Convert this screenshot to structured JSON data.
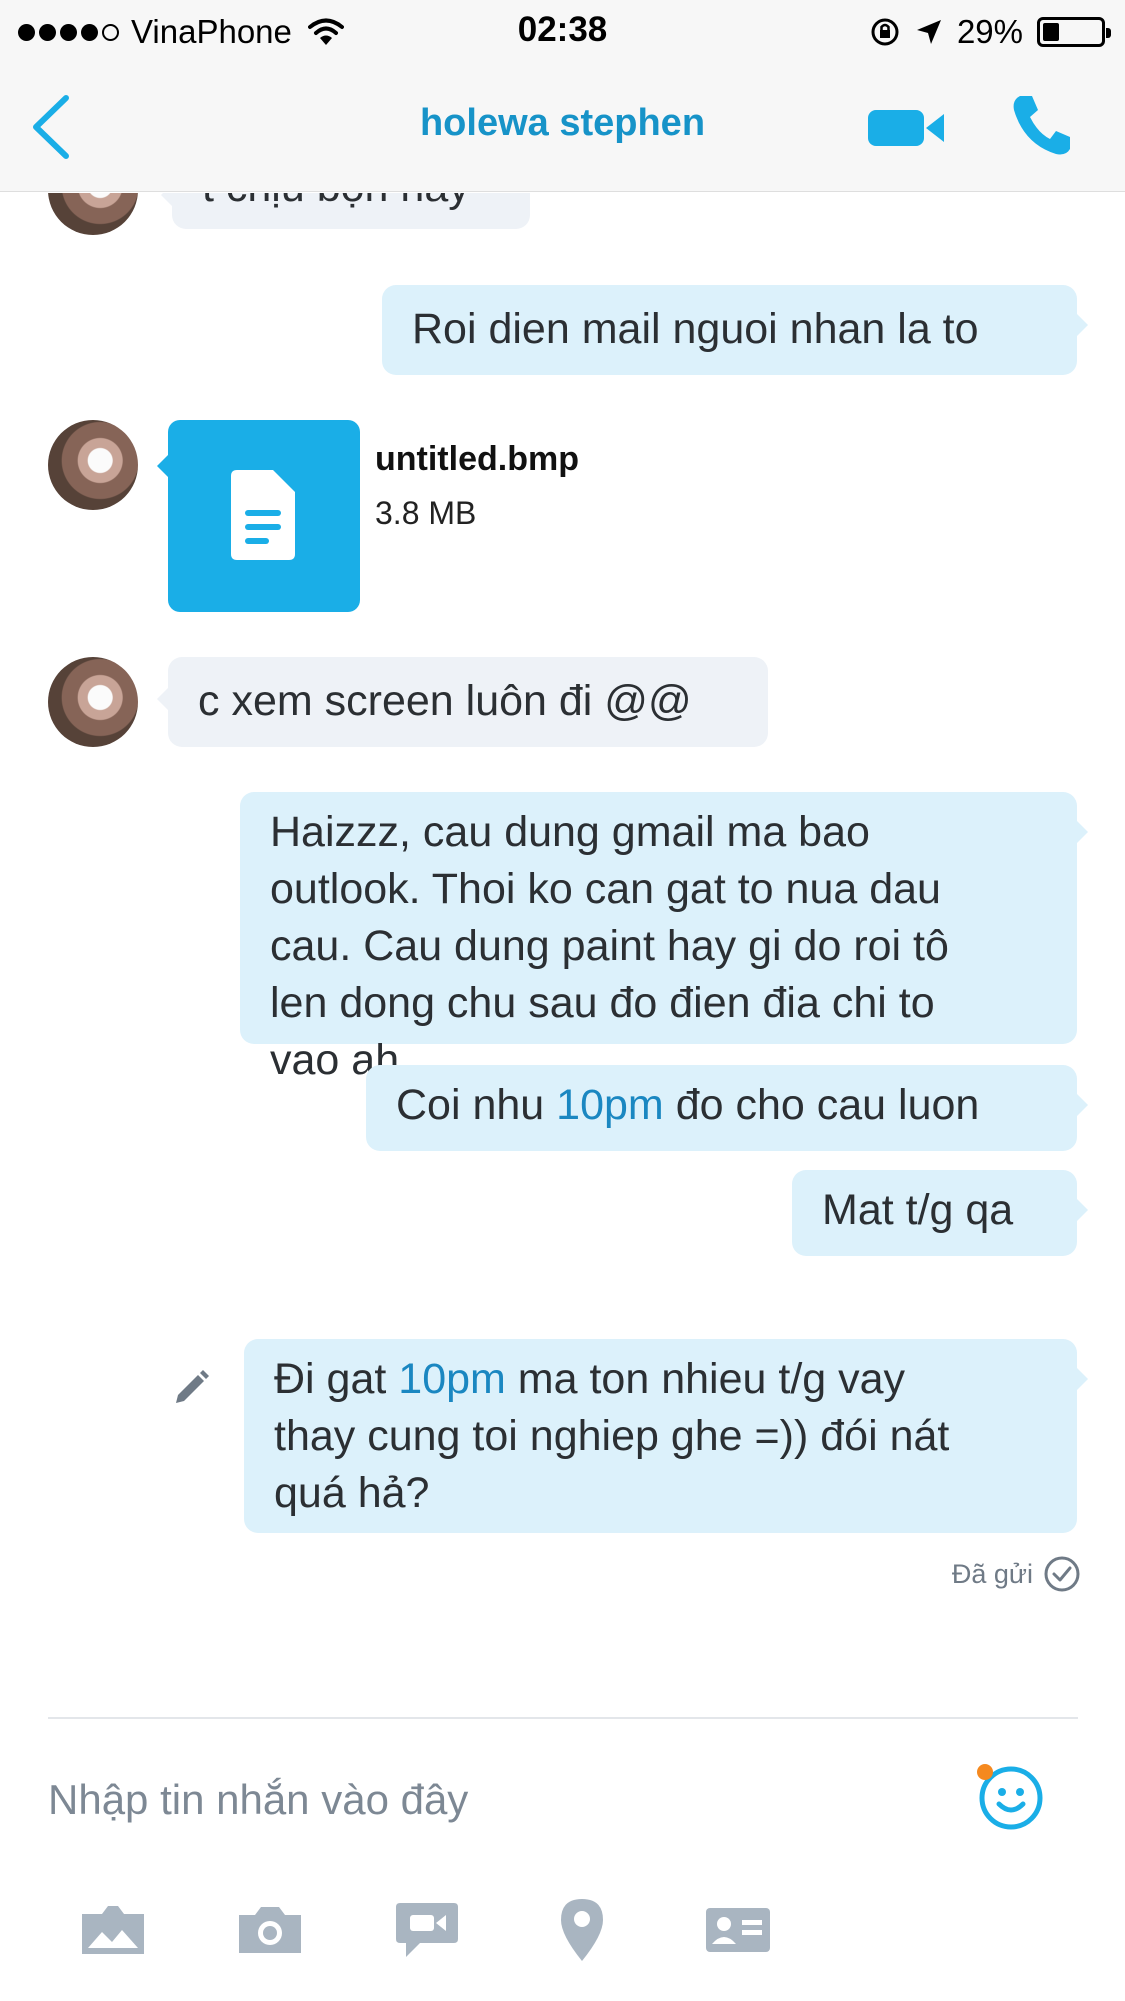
{
  "status_bar": {
    "carrier": "VinaPhone",
    "time": "02:38",
    "battery": "29%",
    "battery_level": 0.29
  },
  "header": {
    "back_icon": "chevron-left-icon",
    "contact_name": "holewa stephen",
    "video_icon": "video-camera-icon",
    "call_icon": "phone-icon"
  },
  "messages": {
    "m0": {
      "sender": "them",
      "text": "t chịu bọn hay"
    },
    "m1": {
      "sender": "me",
      "text": "Roi dien mail nguoi nhan la to"
    },
    "m2": {
      "sender": "them",
      "file_name": "untitled.bmp",
      "file_size": "3.8 MB",
      "icon": "document-icon"
    },
    "m3": {
      "sender": "them",
      "text": "c xem screen luôn đi @@"
    },
    "m4": {
      "sender": "me",
      "lines": [
        "Haizzz, cau dung gmail ma bao",
        "outlook. Thoi ko can gat to nua dau",
        "cau. Cau dung paint hay gi do roi tô",
        "len dong chu sau đo đien đia chi to",
        "vao ah"
      ]
    },
    "m5": {
      "sender": "me",
      "before": "Coi nhu ",
      "link": "10pm",
      "after": " đo cho cau luon"
    },
    "m6": {
      "sender": "me",
      "text": "Mat t/g qa"
    },
    "m7": {
      "sender": "me",
      "l1_before": "Đi gat ",
      "l1_link": "10pm",
      "l1_after": " ma ton nhieu t/g vay",
      "l2": "thay cung toi nghiep ghe =)) đói nát",
      "l3": "quá hả?",
      "edited_icon": "pencil-icon"
    }
  },
  "delivery_status": "Đã gửi",
  "composer": {
    "placeholder": "Nhập tin nhắn vào đây",
    "emoji_icon": "smiley-icon"
  },
  "toolbar": [
    "gallery-icon",
    "camera-icon",
    "video-message-icon",
    "location-pin-icon",
    "contact-card-icon"
  ],
  "colors": {
    "accent": "#1aaee7",
    "header_text": "#1793c8",
    "link": "#1a87c1",
    "outgoing_bubble": "#dcf1fb",
    "incoming_bubble": "#eef2f7"
  }
}
